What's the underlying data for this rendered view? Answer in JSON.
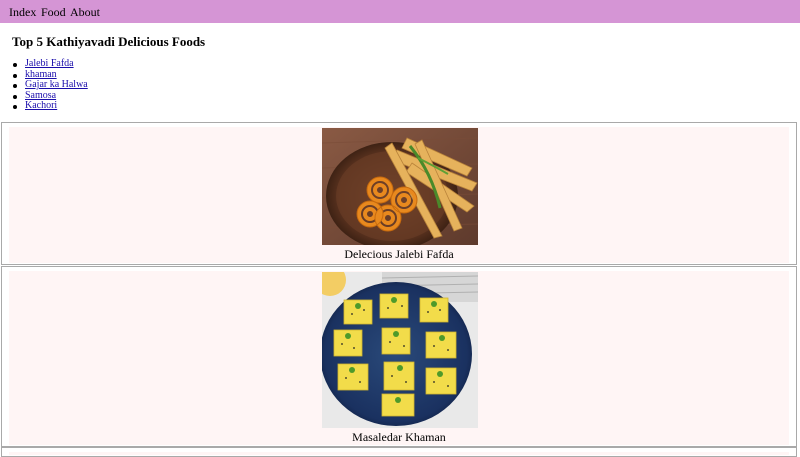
{
  "nav": {
    "items": [
      {
        "label": "Index"
      },
      {
        "label": "Food"
      },
      {
        "label": "About"
      }
    ]
  },
  "page": {
    "title": "Top 5 Kathiyavadi Delicious Foods"
  },
  "food_list": [
    {
      "label": "Jalebi Fafda"
    },
    {
      "label": "khaman"
    },
    {
      "label": "Gajar ka Halwa"
    },
    {
      "label": "Samosa"
    },
    {
      "label": "Kachori"
    }
  ],
  "cards": [
    {
      "caption": "Delecious Jalebi Fafda"
    },
    {
      "caption": "Masaledar Khaman"
    }
  ],
  "colors": {
    "nav_bg": "#d595d5",
    "card_bg": "#fff5f5",
    "link": "#1a0dab"
  }
}
